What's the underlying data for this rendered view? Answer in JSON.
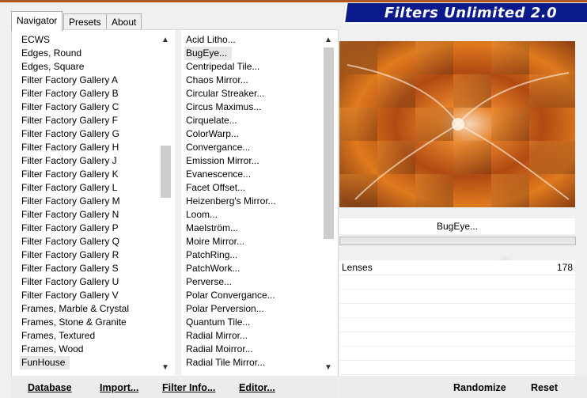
{
  "app": {
    "title": "Filters Unlimited 2.0"
  },
  "tabs": [
    {
      "label": "Navigator",
      "active": true
    },
    {
      "label": "Presets",
      "active": false
    },
    {
      "label": "About",
      "active": false
    }
  ],
  "categories": {
    "items": [
      "ECWS",
      "Edges, Round",
      "Edges, Square",
      "Filter Factory Gallery A",
      "Filter Factory Gallery B",
      "Filter Factory Gallery C",
      "Filter Factory Gallery F",
      "Filter Factory Gallery G",
      "Filter Factory Gallery H",
      "Filter Factory Gallery J",
      "Filter Factory Gallery K",
      "Filter Factory Gallery L",
      "Filter Factory Gallery M",
      "Filter Factory Gallery N",
      "Filter Factory Gallery P",
      "Filter Factory Gallery Q",
      "Filter Factory Gallery R",
      "Filter Factory Gallery S",
      "Filter Factory Gallery U",
      "Filter Factory Gallery V",
      "Frames, Marble & Crystal",
      "Frames, Stone & Granite",
      "Frames, Textured",
      "Frames, Wood",
      "FunHouse"
    ],
    "selected": "FunHouse"
  },
  "filters": {
    "items": [
      "Acid Litho...",
      "BugEye...",
      "Centripedal Tile...",
      "Chaos Mirror...",
      "Circular Streaker...",
      "Circus Maximus...",
      "Cirquelate...",
      "ColorWarp...",
      "Convergance...",
      "Emission Mirror...",
      "Evanescence...",
      "Facet Offset...",
      "Heizenberg's Mirror...",
      "Loom...",
      "Maelström...",
      "Moire Mirror...",
      "PatchRing...",
      "PatchWork...",
      "Perverse...",
      "Polar Convergance...",
      "Polar Perversion...",
      "Quantum Tile...",
      "Radial Mirror...",
      "Radial Moirror...",
      "Radial Tile Mirror..."
    ],
    "selected": "BugEye..."
  },
  "preview": {
    "filter_name": "BugEye..."
  },
  "parameters": [
    {
      "label": "Lenses",
      "value": "178"
    }
  ],
  "buttons": {
    "database": "Database",
    "import": "Import...",
    "filter_info": "Filter Info...",
    "editor": "Editor...",
    "randomize": "Randomize",
    "reset": "Reset"
  },
  "icons": {
    "scroll_up": "chevron-up-icon",
    "scroll_down": "chevron-down-icon"
  },
  "colors": {
    "banner_bg": "#0a1a8a",
    "banner_text": "#ffffff",
    "selection_bg": "#e8e8e8"
  }
}
